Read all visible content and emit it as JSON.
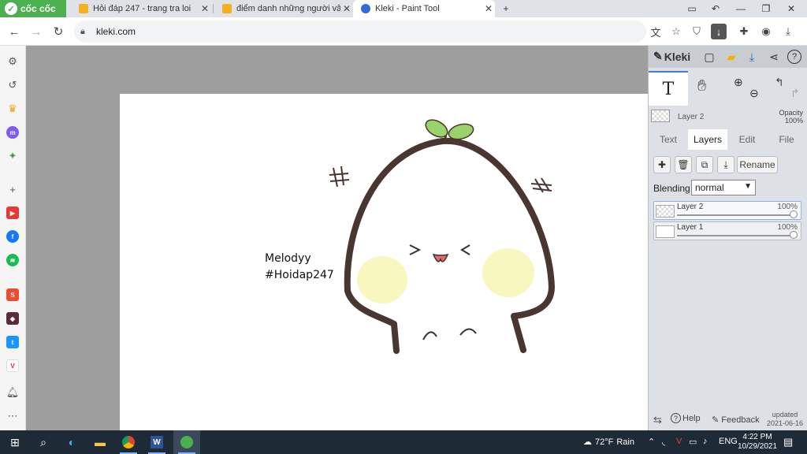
{
  "browser": {
    "brand_label": "cốc cốc",
    "tabs": [
      {
        "title": "Hỏi đáp 247 - trang tra loi",
        "active": false
      },
      {
        "title": "điểm danh những người vẫn",
        "active": false
      },
      {
        "title": "Kleki - Paint Tool",
        "active": true
      }
    ],
    "new_tab_label": "+",
    "url": "kleki.com"
  },
  "canvas": {
    "signature_line1": "Melodyy",
    "signature_line2": "#Hoidap247"
  },
  "kleki": {
    "logo_label": "Kleki",
    "tool_text_label": "T",
    "current_layer_name": "Layer 2",
    "opacity_label": "Opacity",
    "opacity_value": "100%",
    "tabs": [
      "Text",
      "Layers",
      "Edit",
      "File"
    ],
    "active_tab": "Layers",
    "rename_label": "Rename",
    "blending_label": "Blending",
    "blending_value": "normal",
    "layers": [
      {
        "name": "Layer 2",
        "opacity": "100%",
        "opacity_fraction": 1.0,
        "active": true
      },
      {
        "name": "Layer 1",
        "opacity": "100%",
        "opacity_fraction": 1.0,
        "active": false
      }
    ],
    "help_label": "Help",
    "feedback_label": "Feedback",
    "updated_label": "updated",
    "updated_date": "2021-06-16"
  },
  "taskbar": {
    "weather_temp": "72°F",
    "weather_desc": "Rain",
    "language": "ENG",
    "time": "4:22 PM",
    "date": "10/29/2021"
  },
  "colors": {
    "brand_green": "#4caf50",
    "accent_blue": "#3f7ed1",
    "outline_brown": "#4a3631",
    "leaf_green": "#9ad36a",
    "cheek_yellow": "#f8f7c0",
    "mouth_pink": "#e96a6a"
  }
}
